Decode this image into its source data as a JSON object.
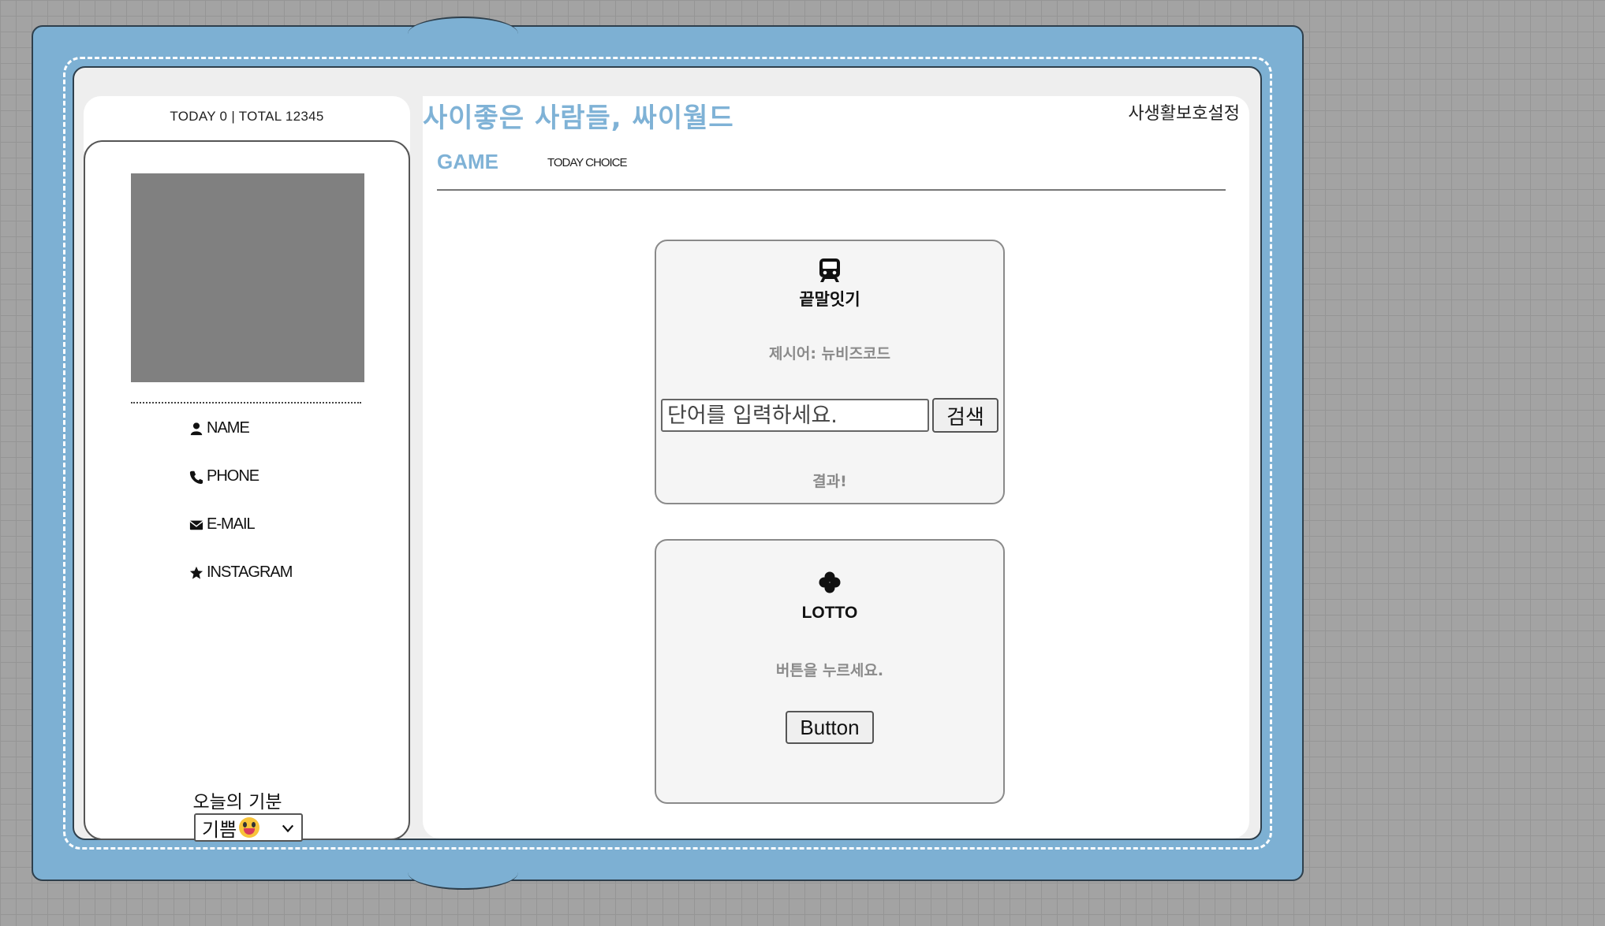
{
  "counter": "TODAY 0 | TOTAL 12345",
  "title": "사이좋은 사람들, 싸이월드",
  "privacy": "사생활보호설정",
  "section": {
    "heading": "GAME",
    "subheading": "TODAY CHOICE"
  },
  "profile": {
    "items": [
      {
        "icon": "user-icon",
        "label": "NAME"
      },
      {
        "icon": "phone-icon",
        "label": "PHONE"
      },
      {
        "icon": "envelope-icon",
        "label": "E-MAIL"
      },
      {
        "icon": "star-icon",
        "label": "INSTAGRAM"
      }
    ],
    "mood_label": "오늘의 기분",
    "mood_value": "기쁨"
  },
  "word_game": {
    "icon": "train-icon",
    "title": "끝말잇기",
    "hint": "제시어: 뉴비즈코드",
    "input_placeholder": "단어를 입력하세요.",
    "button_label": "검색",
    "result": "결과!"
  },
  "lotto": {
    "icon": "clover-icon",
    "title": "LOTTO",
    "hint": "버튼을 누르세요.",
    "button_label": "Button"
  },
  "colors": {
    "frame": "#7db0d3",
    "accent": "#7fb2d6",
    "photo": "#808080"
  }
}
